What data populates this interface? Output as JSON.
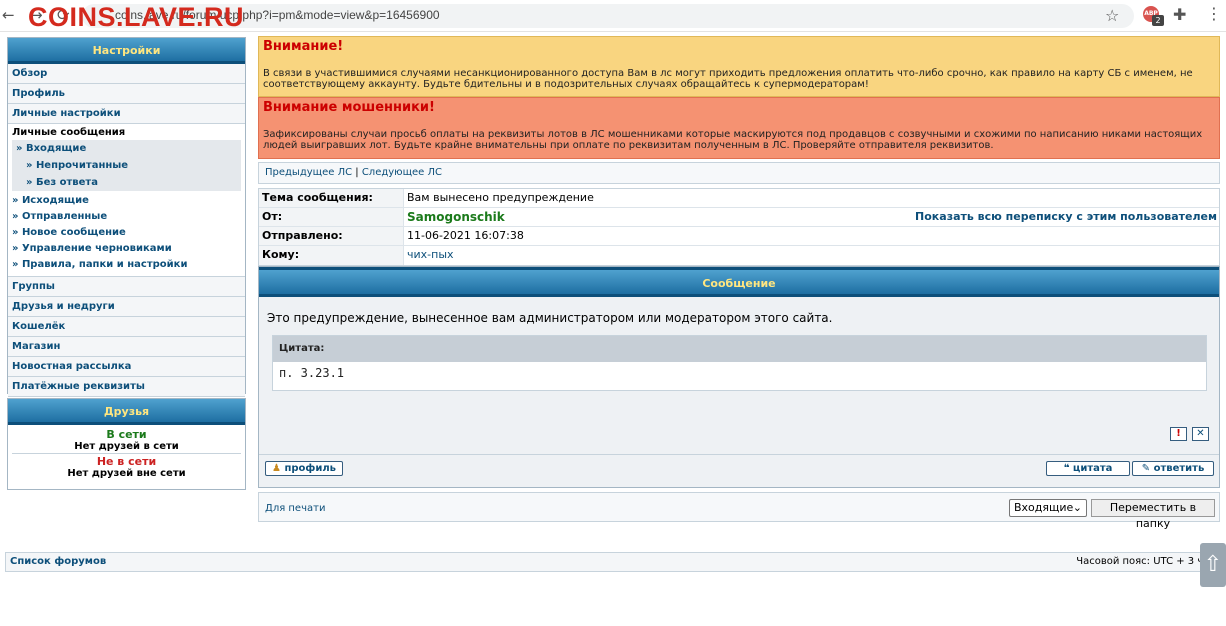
{
  "browser": {
    "url": "coins.lave.ru/forum/ucp.php?i=pm&mode=view&p=16456900",
    "watermark": "COINS.LAVE.RU",
    "extension_badge": "2",
    "extension_label": "ABP"
  },
  "sidebar": {
    "settings_title": "Настройки",
    "items_top": [
      "Обзор",
      "Профиль",
      "Личные настройки"
    ],
    "pm_section": "Личные сообщения",
    "inbox": "» Входящие",
    "inbox_sub": [
      "» Непрочитанные",
      "» Без ответа"
    ],
    "pm_items": [
      "» Исходящие",
      "» Отправленные",
      "» Новое сообщение",
      "» Управление черновиками",
      "» Правила, папки и настройки"
    ],
    "items_bottom": [
      "Группы",
      "Друзья и недруги",
      "Кошелёк",
      "Магазин",
      "Новостная рассылка",
      "Платёжные реквизиты"
    ],
    "friends_title": "Друзья",
    "online_label": "В сети",
    "online_empty": "Нет друзей в сети",
    "offline_label": "Не в сети",
    "offline_empty": "Нет друзей вне сети"
  },
  "notices": {
    "warn_title": "Внимание!",
    "warn_text": "В связи в участившимися случаями несанкционированного доступа Вам в лс могут приходить предложения оплатить что-либо срочно, как правило на карту СБ с именем, не соответствующему аккаунту. Будьте бдительны и в подозрительных случаях обращайтесь к супермодераторам!",
    "fraud_title": "Внимание мошенники!",
    "fraud_text": "Зафиксированы случаи просьб оплаты на реквизиты лотов в ЛС мошенниками которые маскируются под продавцов с созвучными и схожими по написанию никами настоящих людей выигравших лот. Будьте крайне внимательны при оплате по реквизитам полученным в ЛС. Проверяйте отправителя реквизитов."
  },
  "pagination": {
    "prev": "Предыдущее ЛС",
    "sep": "|",
    "next": "Следующее ЛС"
  },
  "message": {
    "subject_label": "Тема сообщения:",
    "subject": "Вам вынесено предупреждение",
    "from_label": "От:",
    "from": "Samogonschik",
    "show_all": "Показать всю переписку с этим пользователем",
    "sent_label": "Отправлено:",
    "sent": "11-06-2021 16:07:38",
    "to_label": "Кому:",
    "to": "чих-пых",
    "section_title": "Сообщение",
    "body": "Это предупреждение, вынесенное вам администратором или модератором этого сайта.",
    "quote_label": "Цитата:",
    "quote_text": "п. 3.23.1",
    "report_glyph": "!",
    "delete_glyph": "✕",
    "profile_btn": "профиль",
    "quote_btn": "цитата",
    "reply_btn": "ответить"
  },
  "bottom": {
    "print": "Для печати",
    "folder": "Входящие",
    "move": "Переместить в папку"
  },
  "footer": {
    "forums": "Список форумов",
    "timezone": "Часовой пояс: UTC + 3 часа"
  },
  "colors": {
    "warn_bg": "#f9d580",
    "fraud_bg": "#f59272",
    "from_color": "#1b7a1b",
    "online": "#1b7a1b",
    "offline": "#cc2222"
  }
}
